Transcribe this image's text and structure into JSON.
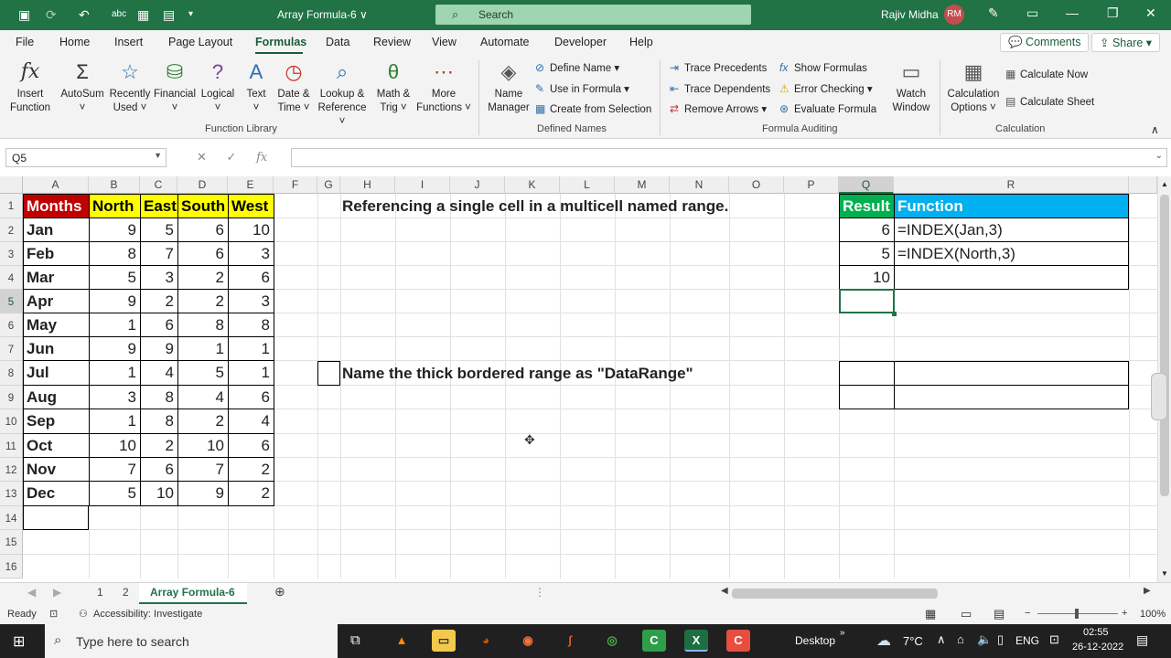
{
  "titlebar": {
    "title": "Array Formula-6 ∨",
    "search_placeholder": "Search",
    "user_name": "Rajiv Midha",
    "user_initials": "RM"
  },
  "tabs": [
    "File",
    "Home",
    "Insert",
    "Page Layout",
    "Formulas",
    "Data",
    "Review",
    "View",
    "Automate",
    "Developer",
    "Help"
  ],
  "active_tab": "Formulas",
  "ribbon_actions": {
    "comments": "Comments",
    "share": "Share"
  },
  "function_library": {
    "group_label": "Function Library",
    "buttons": [
      {
        "line1": "Insert",
        "line2": "Function"
      },
      {
        "line1": "AutoSum",
        "line2": "˅"
      },
      {
        "line1": "Recently",
        "line2": "Used ˅"
      },
      {
        "line1": "Financial",
        "line2": "˅"
      },
      {
        "line1": "Logical",
        "line2": "˅"
      },
      {
        "line1": "Text",
        "line2": "˅"
      },
      {
        "line1": "Date &",
        "line2": "Time ˅"
      },
      {
        "line1": "Lookup &",
        "line2": "Reference ˅"
      },
      {
        "line1": "Math &",
        "line2": "Trig ˅"
      },
      {
        "line1": "More",
        "line2": "Functions ˅"
      }
    ]
  },
  "defined_names": {
    "group_label": "Defined Names",
    "name_manager": {
      "line1": "Name",
      "line2": "Manager"
    },
    "define_name": "Define Name",
    "use_in_formula": "Use in Formula",
    "create_from_selection": "Create from Selection"
  },
  "formula_auditing": {
    "group_label": "Formula Auditing",
    "trace_precedents": "Trace Precedents",
    "trace_dependents": "Trace Dependents",
    "remove_arrows": "Remove Arrows",
    "show_formulas": "Show Formulas",
    "error_checking": "Error Checking",
    "evaluate_formula": "Evaluate Formula",
    "watch_window": {
      "line1": "Watch",
      "line2": "Window"
    }
  },
  "calculation": {
    "group_label": "Calculation",
    "options": {
      "line1": "Calculation",
      "line2": "Options ˅"
    },
    "calculate_now": "Calculate Now",
    "calculate_sheet": "Calculate Sheet"
  },
  "formula_bar": {
    "name_box": "Q5",
    "fx": "fx",
    "formula": ""
  },
  "columns": [
    "A",
    "B",
    "C",
    "D",
    "E",
    "F",
    "G",
    "H",
    "I",
    "J",
    "K",
    "L",
    "M",
    "N",
    "O",
    "P",
    "Q",
    "R"
  ],
  "rows": [
    "1",
    "2",
    "3",
    "4",
    "5",
    "6",
    "7",
    "8",
    "9",
    "10",
    "11",
    "12",
    "13",
    "14",
    "15",
    "16"
  ],
  "table": {
    "headers": [
      "Months",
      "North",
      "East",
      "South",
      "West"
    ],
    "rows": [
      [
        "Jan",
        "9",
        "5",
        "6",
        "10"
      ],
      [
        "Feb",
        "8",
        "7",
        "6",
        "3"
      ],
      [
        "Mar",
        "5",
        "3",
        "2",
        "6"
      ],
      [
        "Apr",
        "9",
        "2",
        "2",
        "3"
      ],
      [
        "May",
        "1",
        "6",
        "8",
        "8"
      ],
      [
        "Jun",
        "9",
        "9",
        "1",
        "1"
      ],
      [
        "Jul",
        "1",
        "4",
        "5",
        "1"
      ],
      [
        "Aug",
        "3",
        "8",
        "4",
        "6"
      ],
      [
        "Sep",
        "1",
        "8",
        "2",
        "4"
      ],
      [
        "Oct",
        "10",
        "2",
        "10",
        "6"
      ],
      [
        "Nov",
        "7",
        "6",
        "7",
        "2"
      ],
      [
        "Dec",
        "5",
        "10",
        "9",
        "2"
      ]
    ]
  },
  "notes": {
    "h1": "Referencing a single cell in a multicell named range.",
    "h8": "Name the thick bordered range as \"DataRange\""
  },
  "results": {
    "header_result": "Result",
    "header_function": "Function",
    "rows": [
      {
        "result": "6",
        "function": "=INDEX(Jan,3)"
      },
      {
        "result": "5",
        "function": "=INDEX(North,3)"
      },
      {
        "result": "10",
        "function": ""
      }
    ]
  },
  "sheet_tabs": [
    "1",
    "2",
    "Array Formula-6"
  ],
  "active_sheet": "Array Formula-6",
  "status": {
    "ready": "Ready",
    "accessibility": "Accessibility: Investigate",
    "zoom": "100%"
  },
  "taskbar": {
    "search_placeholder": "Type here to search",
    "desktop": "Desktop",
    "temperature": "7°C",
    "language": "ENG",
    "time": "02:55",
    "date": "26-12-2022"
  },
  "colors": {
    "excel_green": "#217346",
    "months_header": "#c00000",
    "region_header": "#ffff00",
    "result_header": "#00b050",
    "function_header": "#00b0f0"
  }
}
